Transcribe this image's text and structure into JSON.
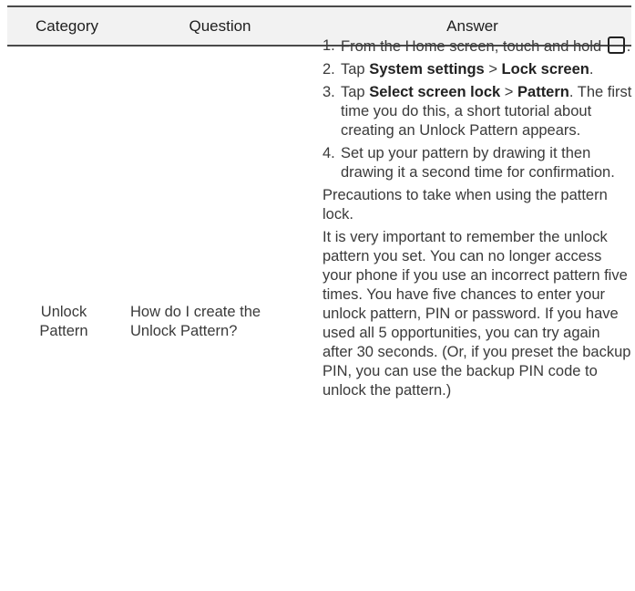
{
  "table": {
    "headers": {
      "category": "Category",
      "question": "Question",
      "answer": "Answer"
    },
    "row": {
      "category_line1": "Unlock",
      "category_line2": "Pattern",
      "question_line1": "How do I create the",
      "question_line2": "Unlock Pattern?",
      "steps": [
        {
          "num": "1.",
          "t1": "From the Home screen, touch and hold",
          "icon": "recent-apps-icon",
          "t2": "."
        },
        {
          "num": "2.",
          "t1": "Tap ",
          "b1": "System settings",
          "t2": " > ",
          "b2": "Lock screen",
          "t3": "."
        },
        {
          "num": "3.",
          "t1": "Tap ",
          "b1": "Select screen lock",
          "t2": " > ",
          "b2": "Pattern",
          "t3": ". The first time you do this, a short tutorial about creating an Unlock Pattern appears."
        },
        {
          "num": "4.",
          "t1": "Set up your pattern by drawing it then drawing it a second time for confirmation."
        }
      ],
      "precautions": "Precautions to take when using the pattern lock.",
      "warning": "It is very important to remember the unlock pattern you set. You can no longer access your phone if you use an incorrect pattern five times. You have five chances to enter your unlock pattern, PIN or password. If you have used all 5 opportunities, you can try again after 30 seconds. (Or, if you preset the backup PIN, you can use the backup PIN code to unlock the pattern.)"
    }
  }
}
